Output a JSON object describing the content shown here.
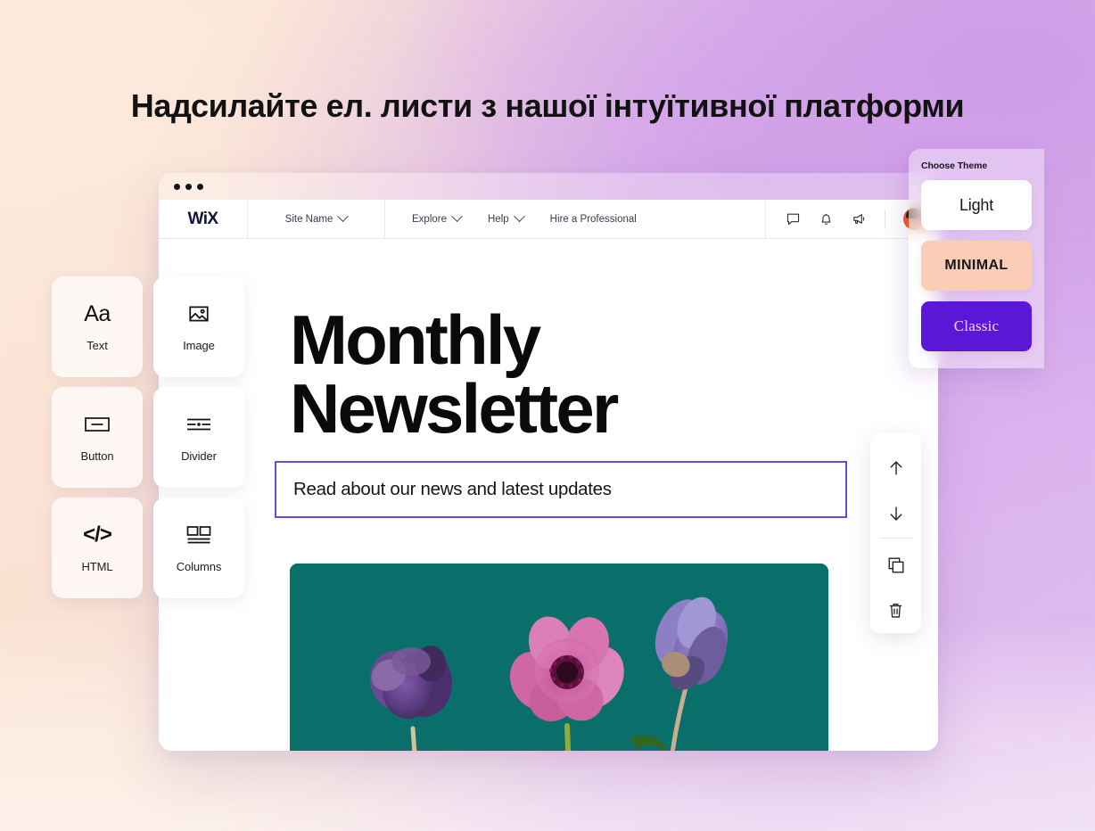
{
  "headline": "Надсилайте ел. листи з нашої інтуїтивної платформи",
  "browser": {
    "window_dots": "window-dots",
    "nav": {
      "logo": "WiX",
      "site_name": "Site Name",
      "links": [
        {
          "label": "Explore",
          "has_chevron": true
        },
        {
          "label": "Help",
          "has_chevron": true
        },
        {
          "label": "Hire a Professional",
          "has_chevron": false
        }
      ],
      "icons": [
        "chat-icon",
        "bell-icon",
        "megaphone-icon"
      ],
      "avatar": "user-avatar"
    },
    "canvas": {
      "heading": "Monthly\nNewsletter",
      "subheading": "Read about our news and latest updates",
      "hero_image_alt": "three-anemone-flowers-on-teal-background",
      "selection_border_color": "#6b46e5"
    }
  },
  "elements_panel": {
    "items": [
      {
        "label": "Text",
        "icon": "text-aa-icon",
        "glyph": "Aa"
      },
      {
        "label": "Image",
        "icon": "image-icon"
      },
      {
        "label": "Button",
        "icon": "button-icon"
      },
      {
        "label": "Divider",
        "icon": "divider-icon"
      },
      {
        "label": "HTML",
        "icon": "html-code-icon",
        "glyph": "</>"
      },
      {
        "label": "Columns",
        "icon": "columns-icon"
      }
    ]
  },
  "action_toolbar": {
    "items": [
      {
        "name": "move-up-icon"
      },
      {
        "name": "move-down-icon"
      },
      {
        "name": "duplicate-icon"
      },
      {
        "name": "delete-icon"
      }
    ]
  },
  "theme_panel": {
    "title": "Choose Theme",
    "options": [
      {
        "label": "Light",
        "bg": "#ffffff",
        "fg": "#17171d"
      },
      {
        "label": "MINIMAL",
        "bg": "#fbcdb6",
        "fg": "#17171d"
      },
      {
        "label": "Classic",
        "bg": "#5b17d8",
        "fg": "#f6d9ee"
      }
    ]
  },
  "colors": {
    "background_peach": "#fde7d6",
    "background_purple": "#dcb2ee",
    "hero_teal": "#0a6f6b",
    "accent_purple": "#5b17d8"
  }
}
